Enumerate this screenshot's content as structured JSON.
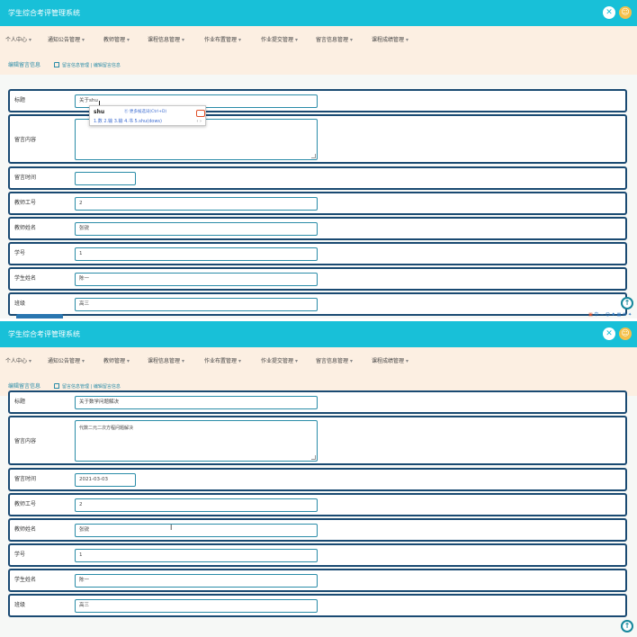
{
  "app": {
    "title": "学生综合考评管理系统",
    "close_icon": "close-icon",
    "user_icon": "user-icon"
  },
  "nav": {
    "items": [
      {
        "label": "个人中心"
      },
      {
        "label": "通知公告管理"
      },
      {
        "label": "教师管理"
      },
      {
        "label": "课程信息管理"
      },
      {
        "label": "作业布置管理"
      },
      {
        "label": "作业提交管理"
      },
      {
        "label": "留言信息管理"
      },
      {
        "label": "课程成绩管理"
      }
    ],
    "caret": "▾"
  },
  "breadcrumb": {
    "page_title": "编辑留言信息",
    "path": "留言信息管理 | 编辑留言信息",
    "home_icon": "home-icon"
  },
  "form_top": {
    "title": {
      "label": "标题",
      "value": "关于shu"
    },
    "content": {
      "label": "留言内容",
      "value": ""
    },
    "time": {
      "label": "留言时间",
      "value": ""
    },
    "teacher_id": {
      "label": "教师工号",
      "value": "2"
    },
    "teacher_name": {
      "label": "教师姓名",
      "value": "张锐"
    },
    "student_id": {
      "label": "学号",
      "value": "1"
    },
    "student_name": {
      "label": "学生姓名",
      "value": "陈一"
    },
    "class": {
      "label": "班级",
      "value": "高三"
    }
  },
  "ime": {
    "pinyin": "shu",
    "hint": "⑪ 更多候选词(Ctrl+D)",
    "candidates": "1.数  2.输  3.输  4.书  5.shu(dows)",
    "arrows": "‹ ›"
  },
  "form_bottom": {
    "title": {
      "label": "标题",
      "value": "关于数学问题解决"
    },
    "content": {
      "label": "留言内容",
      "value": "代数二元二次方程问题解决"
    },
    "time": {
      "label": "留言时间",
      "value": "2021-03-03"
    },
    "teacher_id": {
      "label": "教师工号",
      "value": "2"
    },
    "teacher_name": {
      "label": "教师姓名",
      "value": "张锐"
    },
    "student_id": {
      "label": "学号",
      "value": "1"
    },
    "student_name": {
      "label": "学生姓名",
      "value": "陈一"
    },
    "class": {
      "label": "班级",
      "value": "高三"
    }
  },
  "tray": {
    "text": "中 ∽ ☺ ♦ ▦ ⚙ ✦"
  },
  "colors": {
    "topbar": "#18c0d8",
    "navbar": "#fcefe2",
    "border": "#1a4a72",
    "link": "#2a8ca8"
  }
}
